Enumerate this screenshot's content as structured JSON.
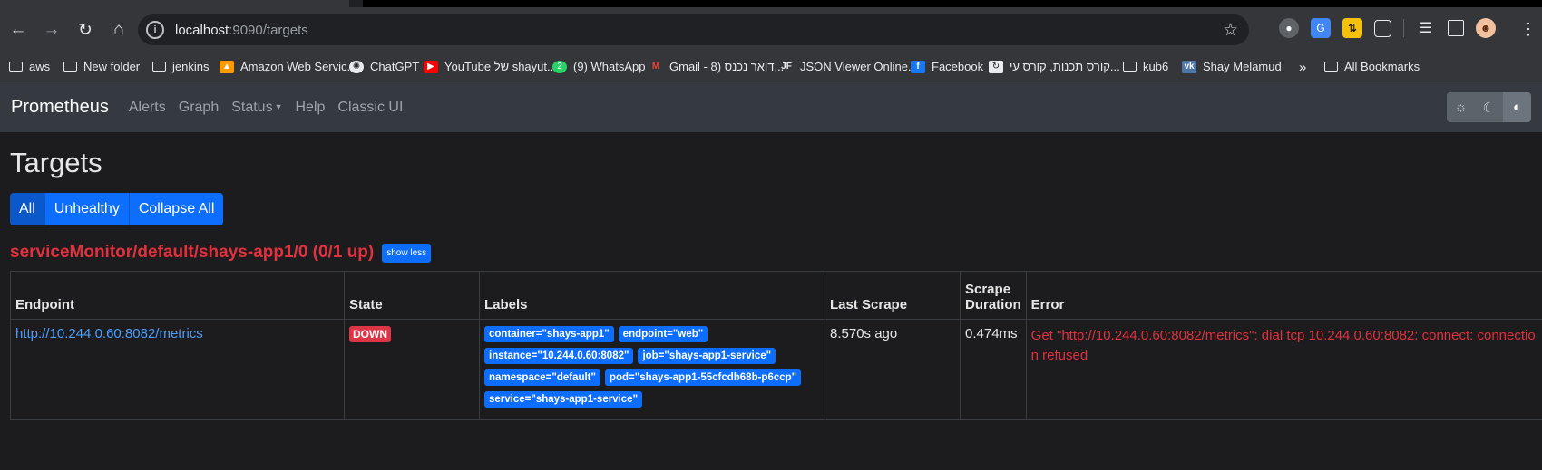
{
  "browser": {
    "url_host": "localhost",
    "url_rest": ":9090/targets",
    "bookmarks": [
      {
        "label": "aws",
        "icon": "folder-icon"
      },
      {
        "label": "New folder",
        "icon": "folder-icon"
      },
      {
        "label": "jenkins",
        "icon": "folder-icon"
      },
      {
        "label": "Amazon Web Servic...",
        "icon": "aws-icon"
      },
      {
        "label": "ChatGPT",
        "icon": "chatgpt-icon"
      },
      {
        "label": "YouTube של shayut...",
        "icon": "youtube-icon"
      },
      {
        "label": "(9) WhatsApp",
        "icon": "whatsapp-icon"
      },
      {
        "label": "Gmail - דואר נכנס (8...",
        "icon": "gmail-icon"
      },
      {
        "label": "JSON Viewer Online...",
        "icon": "jf-icon"
      },
      {
        "label": "Facebook",
        "icon": "facebook-icon"
      },
      {
        "label": "קורס תכנות, קורס עי...",
        "icon": "course-icon"
      },
      {
        "label": "kub6",
        "icon": "folder-icon"
      },
      {
        "label": "Shay Melamud",
        "icon": "vk-icon"
      }
    ],
    "all_bookmarks": "All Bookmarks",
    "overflow": "»"
  },
  "nav": {
    "brand": "Prometheus",
    "links": [
      "Alerts",
      "Graph",
      "Status",
      "Help",
      "Classic UI"
    ]
  },
  "page": {
    "title": "Targets",
    "filters": [
      "All",
      "Unhealthy",
      "Collapse All"
    ],
    "pool_title": "serviceMonitor/default/shays-app1/0 (0/1 up)",
    "show_less": "show less"
  },
  "table": {
    "headers": {
      "endpoint": "Endpoint",
      "state": "State",
      "labels": "Labels",
      "last_scrape": "Last Scrape",
      "scrape_duration_1": "Scrape",
      "scrape_duration_2": "Duration",
      "error": "Error"
    },
    "row": {
      "endpoint": "http://10.244.0.60:8082/metrics",
      "state": "DOWN",
      "labels": [
        "container=\"shays-app1\"",
        "endpoint=\"web\"",
        "instance=\"10.244.0.60:8082\"",
        "job=\"shays-app1-service\"",
        "namespace=\"default\"",
        "pod=\"shays-app1-55cfcdb68b-p6ccp\"",
        "service=\"shays-app1-service\""
      ],
      "last_scrape": "8.570s ago",
      "scrape_duration": "0.474ms",
      "error": "Get \"http://10.244.0.60:8082/metrics\": dial tcp 10.244.0.60:8082: connect: connection refused"
    }
  },
  "colors": {
    "accent": "#0d6efd",
    "down": "#dc3545",
    "error_text": "#e0313e",
    "navbar": "#343a40",
    "background": "#1c1c1e"
  }
}
